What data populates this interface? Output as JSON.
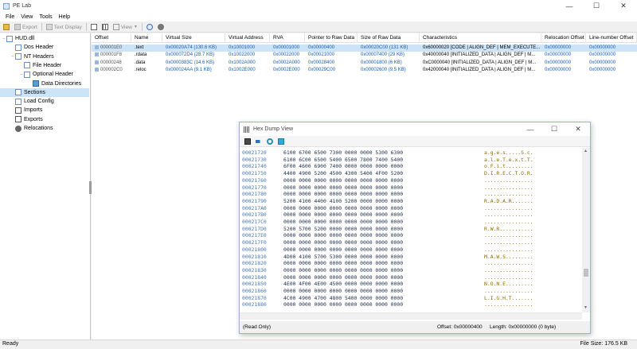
{
  "app": {
    "title": "PE Lab"
  },
  "menu": [
    "File",
    "View",
    "Tools",
    "Help"
  ],
  "toolbar": {
    "export_label": "Export",
    "text_display_label": "Text Display",
    "view_label": "View"
  },
  "tree": [
    {
      "label": "HUD.dll",
      "icon": "page-icon",
      "level": 0,
      "expand": "−"
    },
    {
      "label": "Dos Header",
      "icon": "page-icon",
      "level": 1
    },
    {
      "label": "NT Headers",
      "icon": "page-icon",
      "level": 1,
      "expand": "−"
    },
    {
      "label": "File Header",
      "icon": "page-icon",
      "level": 2
    },
    {
      "label": "Optional Header",
      "icon": "page-icon",
      "level": 2,
      "expand": "−"
    },
    {
      "label": "Data Directories",
      "icon": "folder-icon",
      "level": 3
    },
    {
      "label": "Sections",
      "icon": "page-icon",
      "level": 1,
      "selected": true
    },
    {
      "label": "Load Config",
      "icon": "page-icon",
      "level": 1
    },
    {
      "label": "Imports",
      "icon": "import-icon",
      "level": 1
    },
    {
      "label": "Exports",
      "icon": "export-icon",
      "level": 1
    },
    {
      "label": "Relocations",
      "icon": "gear-icon",
      "level": 1
    }
  ],
  "table": {
    "columns": [
      "Offset",
      "Name",
      "Virtual Size",
      "Virtual Address",
      "RVA",
      "Pointer to Raw Data",
      "Size of Raw Data",
      "Characteristics",
      "Relocation Offset",
      "Line-number Offset"
    ],
    "rows": [
      [
        "000001E0",
        ".text",
        "0x00020A74 (130.6 KB)",
        "0x10001000",
        "0x00001000",
        "0x00000400",
        "0x00020C00 (131 KB)",
        "0x60000020 [CODE | ALIGN_DEF | MEM_EXECUTE...",
        "0x00000000",
        "0x00000000"
      ],
      [
        "000001F8",
        ".rdata",
        "0x000072D4 (28.7 KB)",
        "0x10022000",
        "0x00022000",
        "0x00021000",
        "0x00007400 (29 KB)",
        "0x40000040 [INITIALIZED_DATA | ALIGN_DEF | M...",
        "0x00000000",
        "0x00000000"
      ],
      [
        "00000248",
        ".data",
        "0x0000383C (14.6 KB)",
        "0x1002A000",
        "0x0002A000",
        "0x00028400",
        "0x00001800 (6 KB)",
        "0xC0000040 [INITIALIZED_DATA | ALIGN_DEF | M...",
        "0x00000000",
        "0x00000000"
      ],
      [
        "000002C0",
        ".reloc",
        "0x000024AA (9.1 KB)",
        "0x1002E000",
        "0x0002E000",
        "0x00029C00",
        "0x00002600 (9.5 KB)",
        "0x42000040 [INITIALIZED_DATA | ALIGN_DEF | M...",
        "0x00000000",
        "0x00000000"
      ]
    ]
  },
  "hex": {
    "title": "Hex Dump View",
    "rows": [
      [
        "00021720",
        "6100 6700 6500 7300 0000 0000 5300 6300",
        "a.g.e.s.....S.c."
      ],
      [
        "00021730",
        "6100 6C00 6500 5400 6500 7800 7400 5400",
        "a.l.e.T.e.x.t.T."
      ],
      [
        "00021740",
        "6F00 4600 6900 7400 0000 0000 0000 0000",
        "o.F.i.t........."
      ],
      [
        "00021750",
        "4400 4900 5200 4500 4300 5400 4F00 5200",
        "D.I.R.E.C.T.O.R."
      ],
      [
        "00021760",
        "0000 0000 0000 0000 0000 0000 0000 0000",
        "................"
      ],
      [
        "00021770",
        "0000 0000 0000 0000 0000 0000 0000 0000",
        "................"
      ],
      [
        "00021780",
        "0000 0000 0000 0000 0000 0000 0000 0000",
        "................"
      ],
      [
        "00021790",
        "5200 4100 4400 4100 5200 0000 0000 0000",
        "R.A.D.A.R......."
      ],
      [
        "000217A0",
        "0000 0000 0000 0000 0000 0000 0000 0000",
        "................"
      ],
      [
        "000217B0",
        "0000 0000 0000 0000 0000 0000 0000 0000",
        "................"
      ],
      [
        "000217C0",
        "0000 0000 0000 0000 0000 0000 0000 0000",
        "................"
      ],
      [
        "000217D0",
        "5200 5700 5200 0000 0000 0000 0000 0000",
        "R.W.R..........."
      ],
      [
        "000217E0",
        "0000 0000 0000 0000 0000 0000 0000 0000",
        "................"
      ],
      [
        "000217F0",
        "0000 0000 0000 0000 0000 0000 0000 0000",
        "................"
      ],
      [
        "00021800",
        "0000 0000 0000 0000 0000 0000 0000 0000",
        "................"
      ],
      [
        "00021810",
        "4D00 4100 5700 5300 0000 0000 0000 0000",
        "M.A.W.S........."
      ],
      [
        "00021820",
        "0000 0000 0000 0000 0000 0000 0000 0000",
        "................"
      ],
      [
        "00021830",
        "0000 0000 0000 0000 0000 0000 0000 0000",
        "................"
      ],
      [
        "00021840",
        "0000 0000 0000 0000 0000 0000 0000 0000",
        "................"
      ],
      [
        "00021850",
        "4E00 4F00 4E00 4500 0000 0000 0000 0000",
        "N.O.N.E........."
      ],
      [
        "00021860",
        "0000 0000 0000 0000 0000 0000 0000 0000",
        "................"
      ],
      [
        "00021870",
        "4C00 4900 4700 4800 5400 0000 0000 0000",
        "L.I.G.H.T......."
      ],
      [
        "00021880",
        "0000 0000 0000 0000 0000 0000 0000 0000",
        "................"
      ]
    ],
    "status_left": "(Read Only)",
    "status_offset": "Offset: 0x00000400",
    "status_length": "Length: 0x00000000 (0 byte)"
  },
  "status": {
    "left": "Ready",
    "right": "File Size: 176.5 KB"
  }
}
